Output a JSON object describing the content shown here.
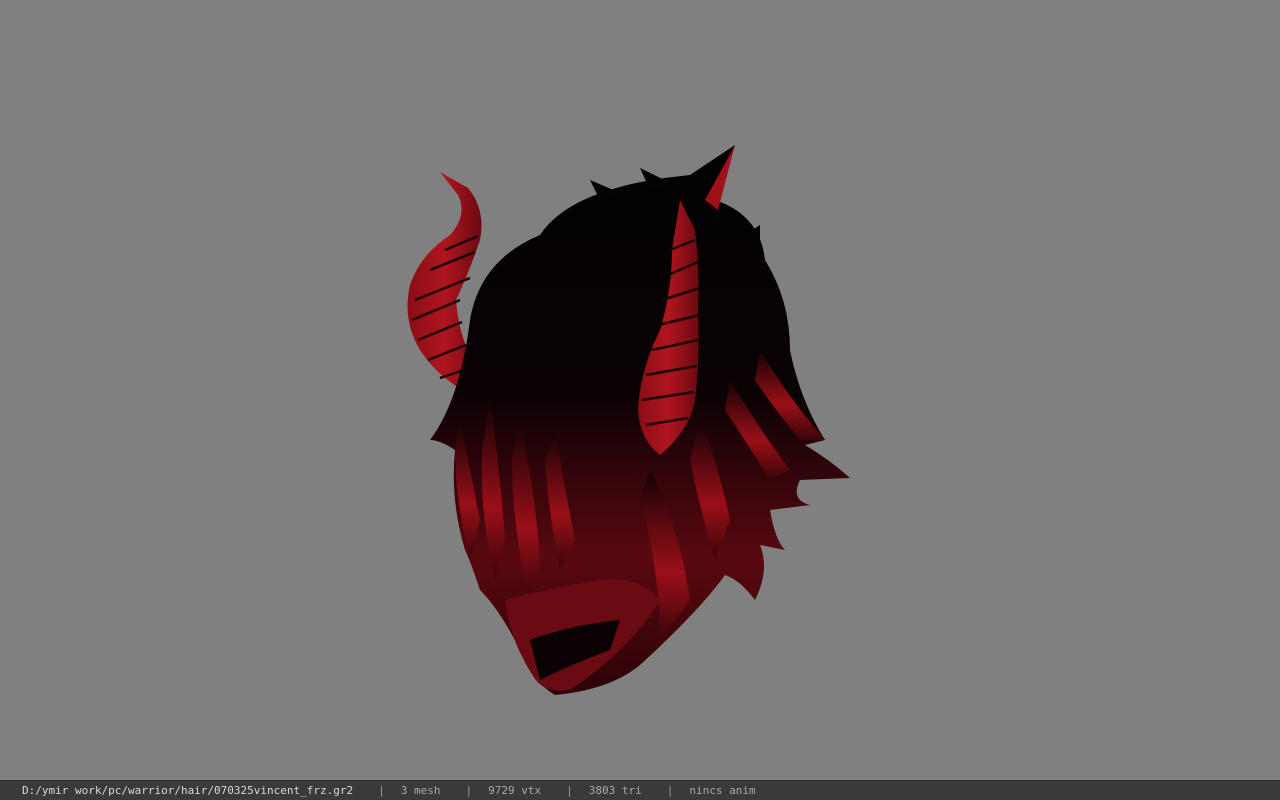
{
  "viewer": {
    "background_color": "#808080",
    "model": {
      "description_icon": "horned-hair-model",
      "primary_color": "#050203",
      "accent_color": "#a0101a"
    }
  },
  "statusbar": {
    "file_path": "D:/ymir work/pc/warrior/hair/070325vincent_frz.gr2",
    "separator": "|",
    "mesh_count": "3 mesh",
    "vertex_count": "9729 vtx",
    "triangle_count": "3803 tri",
    "anim_status": "nincs anim"
  }
}
